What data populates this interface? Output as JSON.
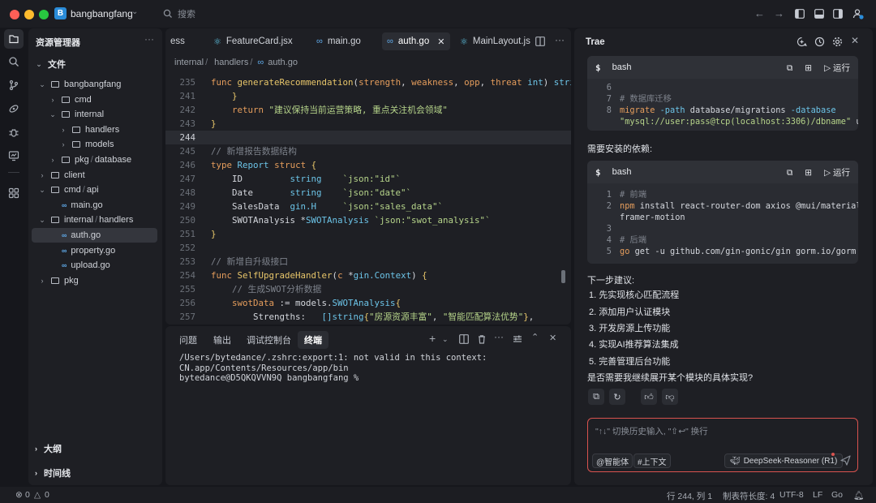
{
  "titlebar": {
    "workspace_badge": "B",
    "workspace_name": "bangbangfang",
    "search_label": "搜索"
  },
  "explorer": {
    "title": "资源管理器",
    "section": "文件",
    "tree": [
      {
        "label": "bangbangfang",
        "kind": "folder",
        "open": true,
        "depth": 0
      },
      {
        "label": "cmd",
        "kind": "folder",
        "open": false,
        "depth": 1
      },
      {
        "label": "internal",
        "kind": "folder",
        "open": true,
        "depth": 1
      },
      {
        "label": "handlers",
        "kind": "folder",
        "open": false,
        "depth": 2
      },
      {
        "label": "models",
        "kind": "folder",
        "open": false,
        "depth": 2
      },
      {
        "label": "pkg",
        "label2": "database",
        "kind": "folder",
        "open": false,
        "depth": 1
      },
      {
        "label": "client",
        "kind": "folder",
        "open": false,
        "depth": 0
      },
      {
        "label": "cmd",
        "label2": "api",
        "kind": "folder",
        "open": true,
        "depth": 0
      },
      {
        "label": "main.go",
        "kind": "go",
        "depth": 1
      },
      {
        "label": "internal",
        "label2": "handlers",
        "kind": "folder",
        "open": true,
        "depth": 0
      },
      {
        "label": "auth.go",
        "kind": "go",
        "depth": 1,
        "selected": true
      },
      {
        "label": "property.go",
        "kind": "go",
        "depth": 1
      },
      {
        "label": "upload.go",
        "kind": "go",
        "depth": 1
      },
      {
        "label": "pkg",
        "kind": "folder",
        "open": false,
        "depth": 0
      }
    ],
    "outline": "大纲",
    "timeline": "时间线"
  },
  "editor": {
    "tabs": [
      {
        "label": "ess",
        "icon": ""
      },
      {
        "label": "FeatureCard.jsx",
        "icon": "react"
      },
      {
        "label": "main.go",
        "icon": "go"
      },
      {
        "label": "auth.go",
        "icon": "go",
        "active": true
      },
      {
        "label": "MainLayout.js",
        "icon": "react"
      }
    ],
    "breadcrumb": [
      "internal",
      "handlers",
      "auth.go"
    ],
    "lines": [
      {
        "n": "235",
        "html": "<span class=\"kw\">func</span> <span class=\"fn\">generateRecommendation</span>(<span class=\"vr\">strength</span>, <span class=\"vr\">weakness</span>, <span class=\"vr\">opp</span>, <span class=\"vr\">threat</span> <span class=\"ty\">int</span>) <span class=\"ty\">string</span>"
      },
      {
        "n": "241",
        "html": "    <span class=\"br\">}</span>"
      },
      {
        "n": "242",
        "html": "    <span class=\"kw\">return</span> <span class=\"st\">\"建议保持当前运营策略, 重点关注机会领域\"</span>"
      },
      {
        "n": "243",
        "html": "<span class=\"br\">}</span>"
      },
      {
        "n": "244",
        "html": "",
        "highlight": true
      },
      {
        "n": "245",
        "html": "<span class=\"cm\">// 新增报告数据结构</span>"
      },
      {
        "n": "246",
        "html": "<span class=\"kw\">type</span> <span class=\"ty\">Report</span> <span class=\"kw\">struct</span> <span class=\"br\">{</span>"
      },
      {
        "n": "247",
        "html": "    ID         <span class=\"ty\">string</span>    <span class=\"st\">`json:\"id\"`</span>"
      },
      {
        "n": "248",
        "html": "    Date       <span class=\"ty\">string</span>    <span class=\"st\">`json:\"date\"`</span>"
      },
      {
        "n": "249",
        "html": "    SalesData  <span class=\"ty\">gin.H</span>     <span class=\"st\">`json:\"sales_data\"`</span>"
      },
      {
        "n": "250",
        "html": "    SWOTAnalysis *<span class=\"ty\">SWOTAnalysis</span> <span class=\"st\">`json:\"swot_analysis\"`</span>"
      },
      {
        "n": "251",
        "html": "<span class=\"br\">}</span>"
      },
      {
        "n": "252",
        "html": ""
      },
      {
        "n": "253",
        "html": "<span class=\"cm\">// 新增自升级接口</span>"
      },
      {
        "n": "254",
        "html": "<span class=\"kw\">func</span> <span class=\"fn\">SelfUpgradeHandler</span>(<span class=\"vr\">c</span> *<span class=\"ty\">gin.Context</span>) <span class=\"br\">{</span>"
      },
      {
        "n": "255",
        "html": "    <span class=\"cm\">// 生成SWOT分析数据</span>"
      },
      {
        "n": "256",
        "html": "    <span class=\"vr\">swotData</span> := models.<span class=\"ty\">SWOTAnalysis</span><span class=\"br\">{</span>"
      },
      {
        "n": "257",
        "html": "        Strengths:   <span class=\"ty\">[]string</span><span class=\"br\">{</span><span class=\"st\">\"房源资源丰富\"</span>, <span class=\"st\">\"智能匹配算法优势\"</span><span class=\"br\">}</span>,"
      }
    ]
  },
  "panel": {
    "tabs": [
      "问题",
      "输出",
      "调试控制台",
      "终端"
    ],
    "active_tab": "终端",
    "terminal": "/Users/bytedance/.zshrc:export:1: not valid in this context: CN.app/Contents/Resources/app/bin\nbytedance@D5QKQVVN9Q bangbangfang %"
  },
  "chat": {
    "title": "Trae",
    "block1": {
      "lang": "bash",
      "run_label": "运行",
      "lines": [
        {
          "n": "6",
          "html": ""
        },
        {
          "n": "7",
          "html": "<span class=\"cm\"># 数据库迁移</span>"
        },
        {
          "n": "8",
          "html": "<span class=\"kw\">migrate</span> <span class=\"ty\">-path</span> database/migrations <span class=\"ty\">-database</span>"
        },
        {
          "n": "",
          "html": "<span class=\"st\">\"mysql://user:pass@tcp(localhost:3306)/dbname\"</span> up"
        }
      ]
    },
    "deps_label": "需要安装的依赖:",
    "block2": {
      "lang": "bash",
      "run_label": "运行",
      "lines": [
        {
          "n": "1",
          "html": "<span class=\"cm\"># 前端</span>"
        },
        {
          "n": "2",
          "html": "<span class=\"kw\">npm</span> install react-router-dom axios @mui/material"
        },
        {
          "n": "",
          "html": "framer-motion"
        },
        {
          "n": "3",
          "html": ""
        },
        {
          "n": "4",
          "html": "<span class=\"cm\"># 后端</span>"
        },
        {
          "n": "5",
          "html": "<span class=\"kw\">go</span> get -u github.com/gin-gonic/gin gorm.io/gorm"
        }
      ]
    },
    "next_label": "下一步建议:",
    "steps": [
      "1. 先实现核心匹配流程",
      "2. 添加用户认证模块",
      "3. 开发房源上传功能",
      "4. 实现AI推荐算法集成",
      "5. 完善管理后台功能"
    ],
    "question": "是否需要我继续展开某个模块的具体实现?",
    "input_placeholder": "\"↑↓\" 切换历史输入, \"⇧↩\" 换行",
    "chip_agent": "@智能体",
    "chip_context": "#上下文",
    "model": "DeepSeek-Reasoner (R1)"
  },
  "status": {
    "errors": "0",
    "warnings": "0",
    "cursor": "行 244, 列 1",
    "tab_size": "制表符长度: 4",
    "encoding": "UTF-8",
    "eol": "LF",
    "lang": "Go"
  },
  "colors": {
    "accent": "#2a8cd9",
    "input_border": "#d9534f",
    "bg": "#16171c",
    "panel": "#1e1f24"
  }
}
